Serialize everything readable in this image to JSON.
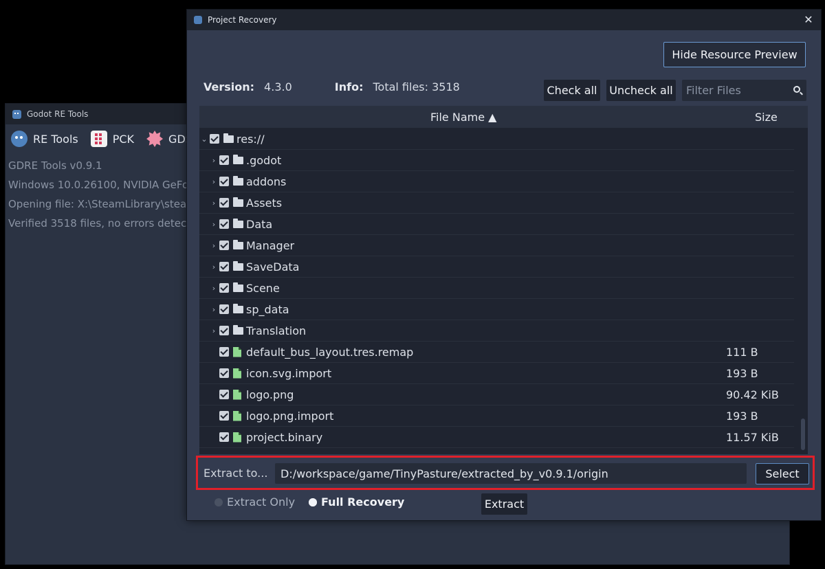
{
  "background": {
    "title": "Godot RE Tools",
    "toolbar": [
      "RE Tools",
      "PCK",
      "GDS"
    ],
    "log": [
      "GDRE Tools v0.9.1",
      "Windows 10.0.26100, NVIDIA GeFo",
      "Opening file: X:\\SteamLibrary\\stea",
      "Verified 3518 files, no errors detec"
    ]
  },
  "dialog": {
    "title": "Project Recovery",
    "close_icon": "close-icon",
    "hide_preview": "Hide Resource Preview",
    "version_label": "Version:",
    "version": "4.3.0",
    "info_label": "Info:",
    "info": "Total files: 3518",
    "check_all": "Check all",
    "uncheck_all": "Uncheck all",
    "filter_placeholder": "Filter Files",
    "columns": {
      "name": "File Name ▲",
      "size": "Size"
    },
    "tree": [
      {
        "name": "res://",
        "type": "folder",
        "level": 0,
        "expanded": true,
        "size": ""
      },
      {
        "name": ".godot",
        "type": "folder",
        "level": 1,
        "expanded": false,
        "size": ""
      },
      {
        "name": "addons",
        "type": "folder",
        "level": 1,
        "expanded": false,
        "size": ""
      },
      {
        "name": "Assets",
        "type": "folder",
        "level": 1,
        "expanded": false,
        "size": ""
      },
      {
        "name": "Data",
        "type": "folder",
        "level": 1,
        "expanded": false,
        "size": ""
      },
      {
        "name": "Manager",
        "type": "folder",
        "level": 1,
        "expanded": false,
        "size": ""
      },
      {
        "name": "SaveData",
        "type": "folder",
        "level": 1,
        "expanded": false,
        "size": ""
      },
      {
        "name": "Scene",
        "type": "folder",
        "level": 1,
        "expanded": false,
        "size": ""
      },
      {
        "name": "sp_data",
        "type": "folder",
        "level": 1,
        "expanded": false,
        "size": ""
      },
      {
        "name": "Translation",
        "type": "folder",
        "level": 1,
        "expanded": false,
        "size": ""
      },
      {
        "name": "default_bus_layout.tres.remap",
        "type": "file",
        "level": 1,
        "size": "111 B"
      },
      {
        "name": "icon.svg.import",
        "type": "file",
        "level": 1,
        "size": "193 B"
      },
      {
        "name": "logo.png",
        "type": "file",
        "level": 1,
        "size": "90.42 KiB"
      },
      {
        "name": "logo.png.import",
        "type": "file",
        "level": 1,
        "size": "193 B"
      },
      {
        "name": "project.binary",
        "type": "file",
        "level": 1,
        "size": "11.57 KiB"
      }
    ],
    "extract_label": "Extract to...",
    "extract_path": "D:/workspace/game/TinyPasture/extracted_by_v0.9.1/origin",
    "select": "Select",
    "modes": [
      {
        "label": "Extract Only",
        "selected": false
      },
      {
        "label": "Full Recovery",
        "selected": true
      }
    ],
    "extract_button": "Extract",
    "highlight_color": "#e0202a"
  }
}
